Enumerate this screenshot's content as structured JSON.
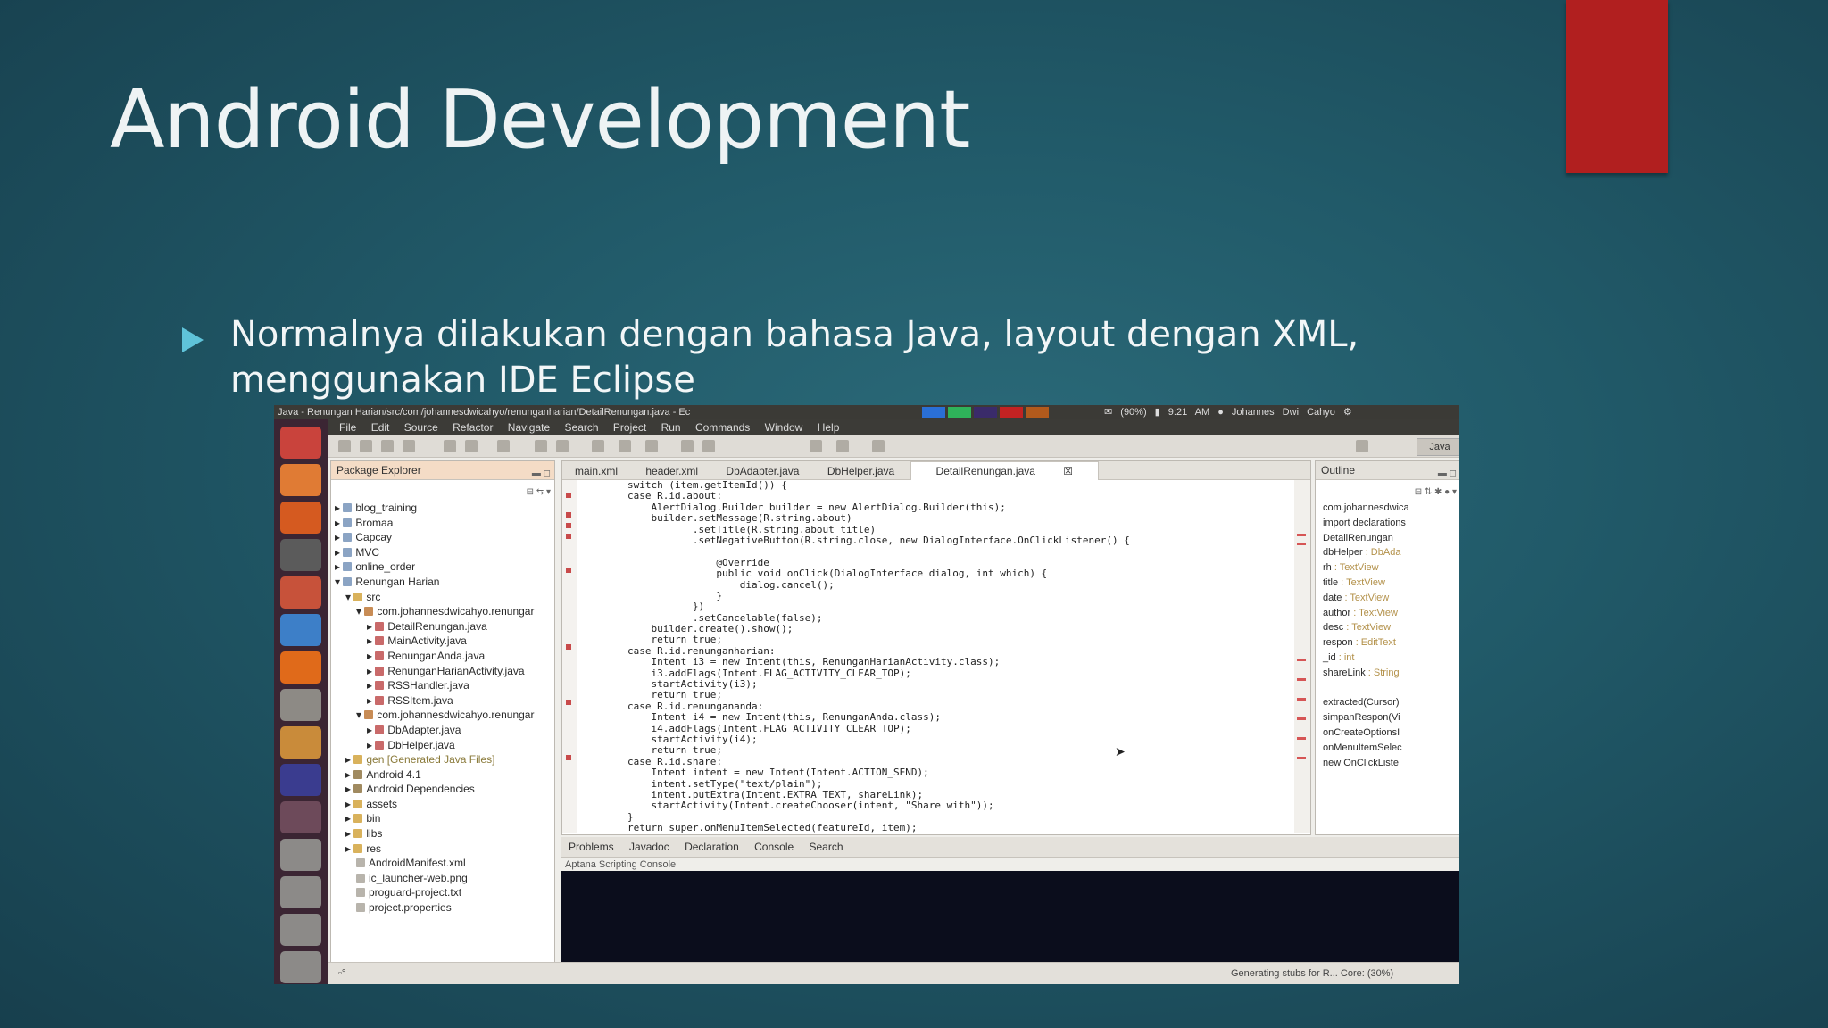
{
  "slide": {
    "title": "Android Development",
    "bullet_line1": "Normalnya dilakukan dengan bahasa Java, layout dengan XML,",
    "bullet_line2": "menggunakan IDE Eclipse",
    "accent_color": "#b11f1f"
  },
  "eclipse": {
    "window_title": "Java - Renungan Harian/src/com/johannesdwicahyo/renunganharian/DetailRenungan.java - Ec",
    "tray_battery": "(90%)",
    "tray_time": "9:21 AM",
    "tray_user": "Johannes Dwi Cahyo",
    "menu": [
      "File",
      "Edit",
      "Source",
      "Refactor",
      "Navigate",
      "Search",
      "Project",
      "Run",
      "Commands",
      "Window",
      "Help"
    ],
    "perspective": "Java",
    "package_explorer": {
      "title": "Package Explorer",
      "items": [
        "blog_training",
        "Bromaa",
        "Capcay",
        "MVC",
        "online_order",
        "Renungan Harian",
        "src",
        "com.johannesdwicahyo.renungar",
        "DetailRenungan.java",
        "MainActivity.java",
        "RenunganAnda.java",
        "RenunganHarianActivity.java",
        "RSSHandler.java",
        "RSSItem.java",
        "com.johannesdwicahyo.renungar",
        "DbAdapter.java",
        "DbHelper.java",
        "gen [Generated Java Files]",
        "Android 4.1",
        "Android Dependencies",
        "assets",
        "bin",
        "libs",
        "res",
        "AndroidManifest.xml",
        "ic_launcher-web.png",
        "proguard-project.txt",
        "project.properties"
      ]
    },
    "editor_tabs": [
      "main.xml",
      "header.xml",
      "DbAdapter.java",
      "DbHelper.java",
      "DetailRenungan.java"
    ],
    "code_lines": [
      "        switch (item.getItemId()) {",
      "        case R.id.about:",
      "            AlertDialog.Builder builder = new AlertDialog.Builder(this);",
      "            builder.setMessage(R.string.about)",
      "                   .setTitle(R.string.about_title)",
      "                   .setNegativeButton(R.string.close, new DialogInterface.OnClickListener() {",
      "",
      "                       @Override",
      "                       public void onClick(DialogInterface dialog, int which) {",
      "                           dialog.cancel();",
      "                       }",
      "                   })",
      "                   .setCancelable(false);",
      "            builder.create().show();",
      "            return true;",
      "        case R.id.renunganharian:",
      "            Intent i3 = new Intent(this, RenunganHarianActivity.class);",
      "            i3.addFlags(Intent.FLAG_ACTIVITY_CLEAR_TOP);",
      "            startActivity(i3);",
      "            return true;",
      "        case R.id.renungananda:",
      "            Intent i4 = new Intent(this, RenunganAnda.class);",
      "            i4.addFlags(Intent.FLAG_ACTIVITY_CLEAR_TOP);",
      "            startActivity(i4);",
      "            return true;",
      "        case R.id.share:",
      "            Intent intent = new Intent(Intent.ACTION_SEND);",
      "            intent.setType(\"text/plain\");",
      "            intent.putExtra(Intent.EXTRA_TEXT, shareLink);",
      "            startActivity(Intent.createChooser(intent, \"Share with\"));",
      "        }",
      "        return super.onMenuItemSelected(featureId, item);"
    ],
    "outline": {
      "title": "Outline",
      "items": [
        {
          "name": "com.johannesdwica",
          "type": ""
        },
        {
          "name": "import declarations",
          "type": ""
        },
        {
          "name": "DetailRenungan",
          "type": ""
        },
        {
          "name": "dbHelper",
          "type": " : DbAda"
        },
        {
          "name": "rh",
          "type": " : TextView"
        },
        {
          "name": "title",
          "type": " : TextView"
        },
        {
          "name": "date",
          "type": " : TextView"
        },
        {
          "name": "author",
          "type": " : TextView"
        },
        {
          "name": "desc",
          "type": " : TextView"
        },
        {
          "name": "respon",
          "type": " : EditText"
        },
        {
          "name": "_id",
          "type": " : int"
        },
        {
          "name": "shareLink",
          "type": " : String"
        },
        {
          "name": "",
          "type": ""
        },
        {
          "name": "extracted(Cursor)",
          "type": ""
        },
        {
          "name": "simpanRespon(Vi",
          "type": ""
        },
        {
          "name": "onCreateOptionsI",
          "type": ""
        },
        {
          "name": "onMenuItemSelec",
          "type": ""
        },
        {
          "name": "new OnClickListe",
          "type": ""
        }
      ]
    },
    "console_tabs": [
      "Problems",
      "Javadoc",
      "Declaration",
      "Console",
      "Search"
    ],
    "console_title": "Aptana Scripting Console",
    "status_text": "Generating stubs for R... Core: (30%)"
  }
}
